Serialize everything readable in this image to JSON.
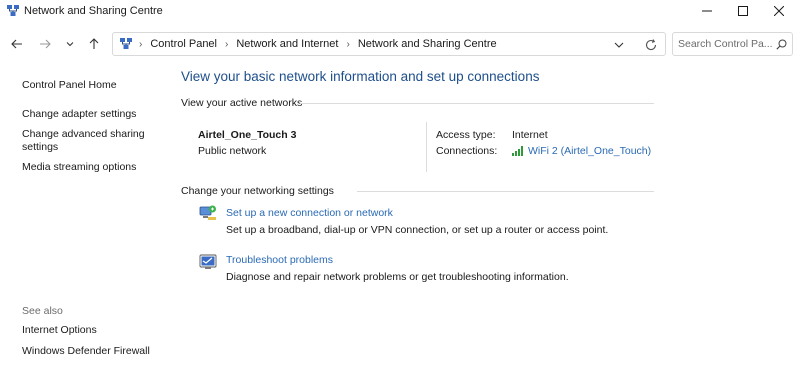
{
  "window": {
    "title": "Network and Sharing Centre"
  },
  "address": {
    "breadcrumbs": [
      "Control Panel",
      "Network and Internet",
      "Network and Sharing Centre"
    ]
  },
  "search": {
    "placeholder": "Search Control Pa..."
  },
  "sidebar": {
    "links": [
      {
        "label": "Control Panel Home"
      },
      {
        "label": "Change adapter settings"
      },
      {
        "label": "Change advanced sharing\nsettings"
      },
      {
        "label": "Media streaming options"
      }
    ],
    "see_also_heading": "See also",
    "see_also": [
      {
        "label": "Internet Options"
      },
      {
        "label": "Windows Defender Firewall"
      }
    ]
  },
  "main": {
    "title": "View your basic network information and set up connections",
    "active_heading": "View your active networks",
    "network": {
      "name": "Airtel_One_Touch 3",
      "type": "Public network",
      "access_type_label": "Access type:",
      "access_type_value": "Internet",
      "connections_label": "Connections:",
      "connections_value": "WiFi 2 (Airtel_One_Touch)"
    },
    "change_heading": "Change your networking settings",
    "tasks": [
      {
        "link": "Set up a new connection or network",
        "description": "Set up a broadband, dial-up or VPN connection, or set up a router or access point."
      },
      {
        "link": "Troubleshoot problems",
        "description": "Diagnose and repair network problems or get troubleshooting information."
      }
    ]
  },
  "colors": {
    "link": "#2a6ab4",
    "title": "#1e4f8c",
    "separator": "#dcdcdc"
  },
  "icons": {
    "app": "network-sharing-icon",
    "back": "arrow-left-icon",
    "forward": "arrow-right-icon",
    "recent": "chevron-down-icon",
    "up": "arrow-up-icon",
    "refresh": "refresh-icon",
    "search": "search-icon",
    "wifi": "wifi-signal-icon"
  }
}
